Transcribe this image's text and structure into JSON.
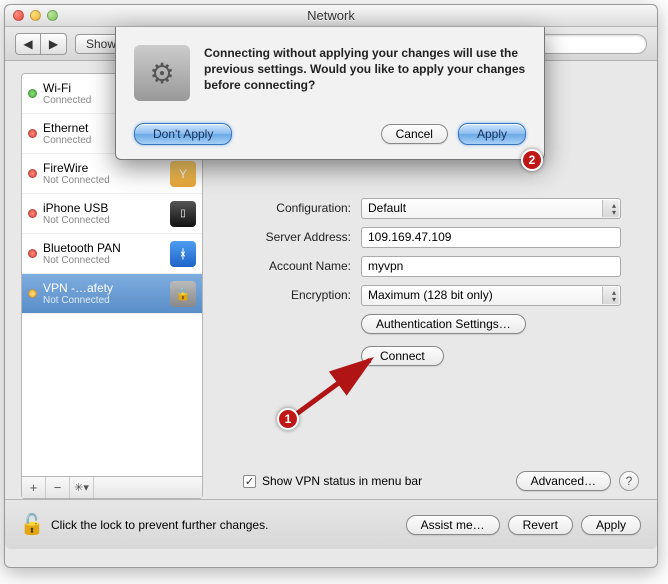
{
  "window": {
    "title": "Network"
  },
  "toolbar": {
    "show_all": "Show All",
    "search_placeholder": ""
  },
  "sidebar": {
    "items": [
      {
        "name": "Wi-Fi",
        "status": "Connected"
      },
      {
        "name": "Ethernet",
        "status": "Connected"
      },
      {
        "name": "FireWire",
        "status": "Not Connected"
      },
      {
        "name": "iPhone USB",
        "status": "Not Connected"
      },
      {
        "name": "Bluetooth PAN",
        "status": "Not Connected"
      },
      {
        "name": "VPN -…afety",
        "status": "Not Connected"
      }
    ],
    "footer": {
      "plus": "+",
      "minus": "−",
      "gear": "✳︎▾"
    }
  },
  "form": {
    "configuration_label": "Configuration:",
    "configuration_value": "Default",
    "server_label": "Server Address:",
    "server_value": "109.169.47.109",
    "account_label": "Account Name:",
    "account_value": "myvpn",
    "encryption_label": "Encryption:",
    "encryption_value": "Maximum (128 bit only)",
    "auth_button": "Authentication Settings…",
    "connect_button": "Connect",
    "show_status_label": "Show VPN status in menu bar",
    "advanced_button": "Advanced…"
  },
  "footer": {
    "lock_text": "Click the lock to prevent further changes.",
    "assist": "Assist me…",
    "revert": "Revert",
    "apply": "Apply"
  },
  "dialog": {
    "message": "Connecting without applying your changes will use the previous settings. Would you like to apply your changes before connecting?",
    "dont_apply": "Don't Apply",
    "cancel": "Cancel",
    "apply": "Apply"
  },
  "callouts": {
    "one": "1",
    "two": "2"
  }
}
